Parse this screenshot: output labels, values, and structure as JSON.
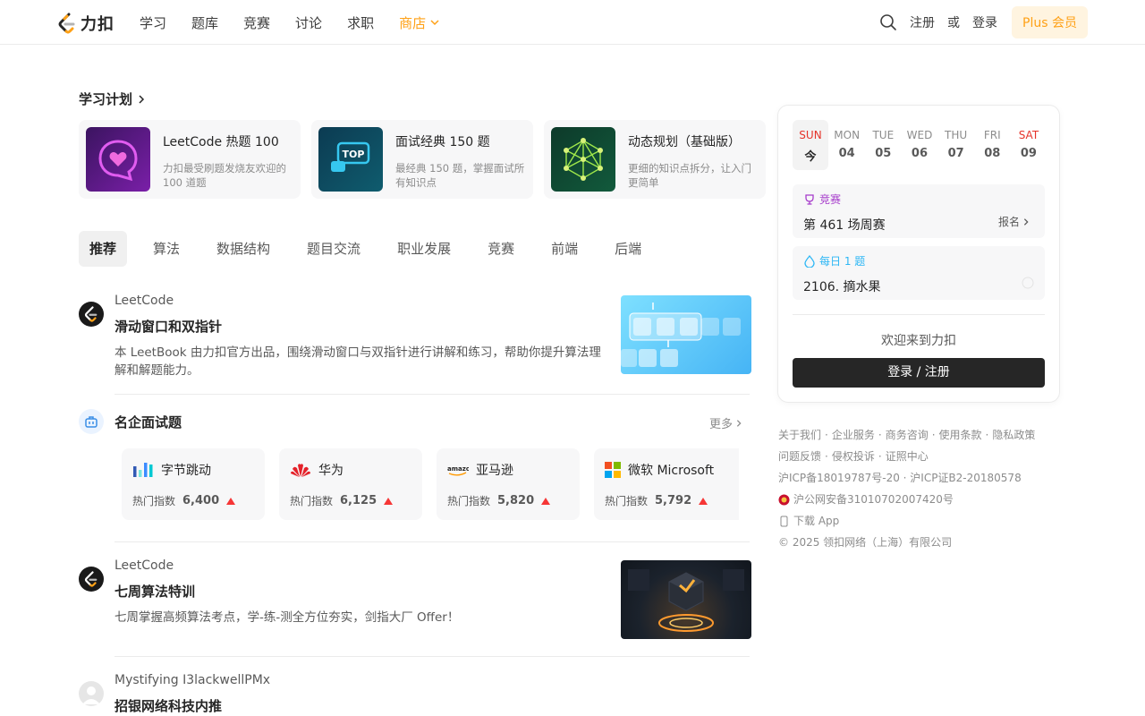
{
  "header": {
    "logo_text": "力扣",
    "nav": [
      "学习",
      "题库",
      "竞赛",
      "讨论",
      "求职"
    ],
    "nav_active": "商店",
    "signup": "注册",
    "or": "或",
    "login": "登录",
    "plus": "Plus 会员"
  },
  "study_plans": {
    "title": "学习计划",
    "items": [
      {
        "title": "LeetCode 热题 100",
        "desc": "力扣最受刷题发烧友欢迎的 100 道题"
      },
      {
        "title": "面试经典 150 题",
        "desc": "最经典 150 题，掌握面试所有知识点"
      },
      {
        "title": "动态规划（基础版）",
        "desc": "更细的知识点拆分，让入门更简单"
      }
    ],
    "badge_top": "TOP"
  },
  "tabs": [
    "推荐",
    "算法",
    "数据结构",
    "题目交流",
    "职业发展",
    "竞赛",
    "前端",
    "后端"
  ],
  "feed": [
    {
      "author": "LeetCode",
      "title": "滑动窗口和双指针",
      "desc": "本 LeetBook 由力扣官方出品，围绕滑动窗口与双指针进行讲解和练习，帮助你提升算法理解和解题能力。"
    },
    {
      "author": "LeetCode",
      "title": "七周算法特训",
      "desc": "七周掌握高频算法考点，学-练-测全方位夯实，剑指大厂 Offer！"
    },
    {
      "author": "Mystifying I3lackwellPMx",
      "title": "招银网络科技内推"
    }
  ],
  "companies": {
    "title": "名企面试题",
    "more": "更多",
    "hot_label": "热门指数",
    "items": [
      {
        "name": "字节跳动",
        "hot": "6,400"
      },
      {
        "name": "华为",
        "hot": "6,125"
      },
      {
        "name": "亚马逊",
        "hot": "5,820",
        "logo_text": "amazon"
      },
      {
        "name": "微软 Microsoft",
        "hot": "5,792"
      }
    ]
  },
  "sidebar": {
    "days": [
      {
        "name": "SUN",
        "num": "今"
      },
      {
        "name": "MON",
        "num": "04"
      },
      {
        "name": "TUE",
        "num": "05"
      },
      {
        "name": "WED",
        "num": "06"
      },
      {
        "name": "THU",
        "num": "07"
      },
      {
        "name": "FRI",
        "num": "08"
      },
      {
        "name": "SAT",
        "num": "09"
      }
    ],
    "contest_label": "竞赛",
    "contest_name": "第 461 场周赛",
    "contest_action": "报名",
    "daily_label": "每日 1 题",
    "daily_problem": "2106. 摘水果",
    "welcome": "欢迎来到力扣",
    "login_button": "登录 / 注册"
  },
  "footer": {
    "line1": [
      "关于我们",
      "企业服务",
      "商务咨询",
      "使用条款",
      "隐私政策"
    ],
    "line2": [
      "问题反馈",
      "侵权投诉",
      "证照中心"
    ],
    "icp": "沪ICP备18019787号-20 · 沪ICP证B2-20180578",
    "police": "沪公网安备31010702007420号",
    "download": "下载 App",
    "copyright": "© 2025 领扣网络（上海）有限公司"
  }
}
